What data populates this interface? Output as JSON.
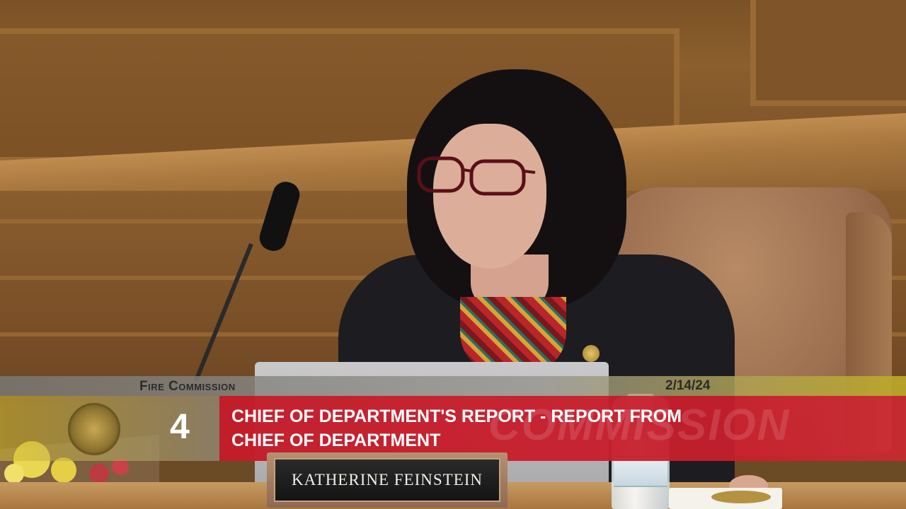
{
  "broadcast": {
    "organization": "Fire Commission",
    "date": "2/14/24",
    "agenda_number": "4",
    "agenda_title_line1": "CHIEF OF DEPARTMENT'S REPORT - REPORT FROM",
    "agenda_title_line2": "CHIEF OF DEPARTMENT",
    "watermark": "COMMISSION"
  },
  "nameplate": {
    "name": "KATHERINE FEINSTEIN"
  },
  "colors": {
    "title_bar_red": "#c41c2a",
    "date_bar_gold": "#bea428",
    "wood": "#8a5d2e"
  }
}
